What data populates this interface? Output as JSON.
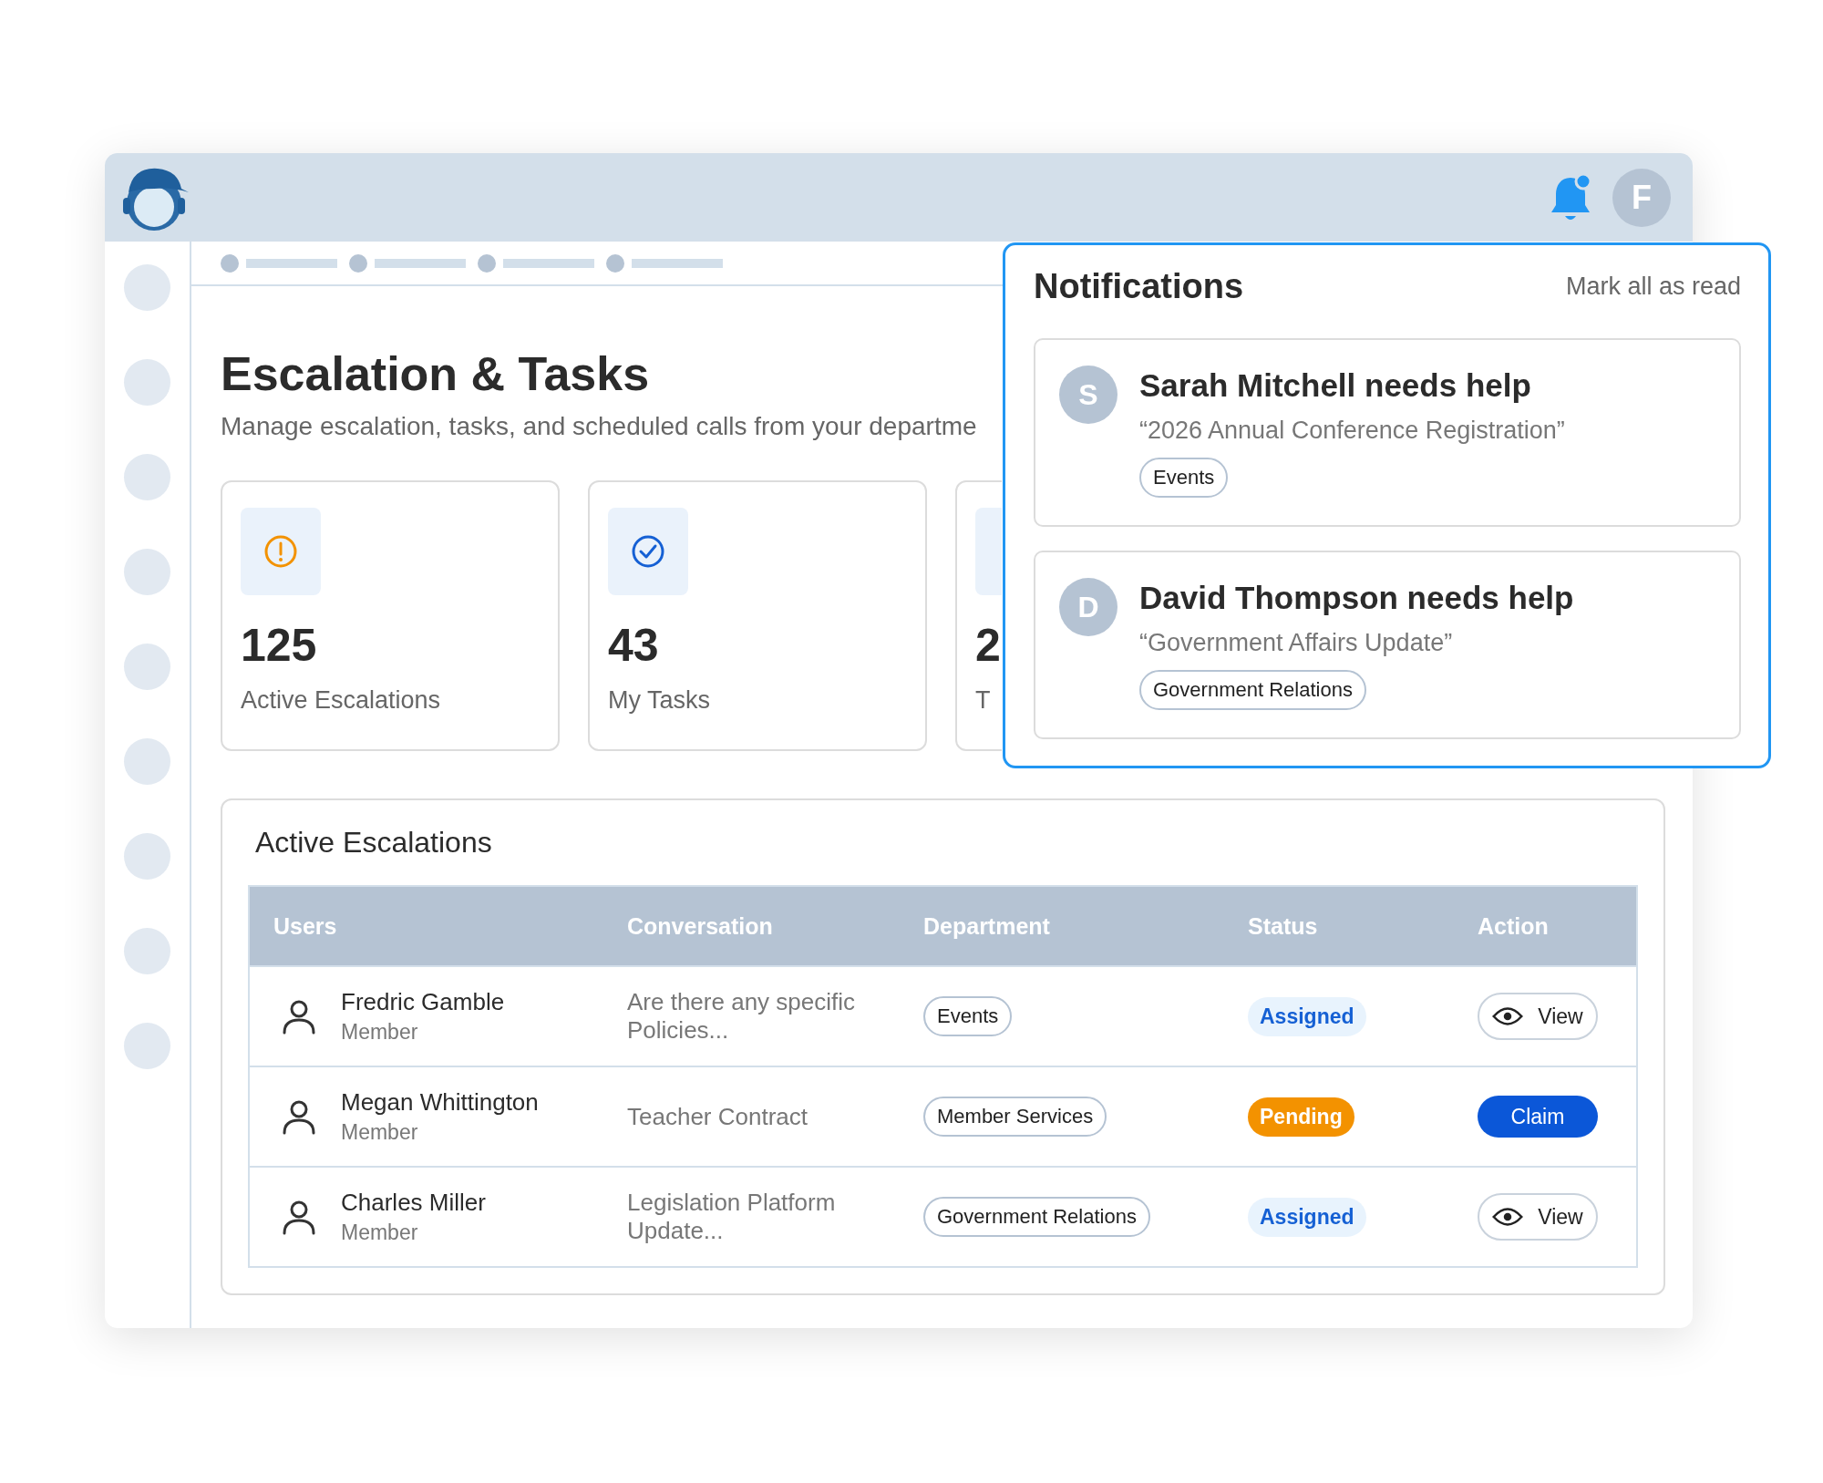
{
  "header": {
    "avatar_letter": "F",
    "notifications_unread": true
  },
  "page": {
    "title": "Escalation & Tasks",
    "subtitle": "Manage escalation, tasks, and scheduled calls from your departme"
  },
  "stats": [
    {
      "kind": "escalation",
      "value": "125",
      "label": "Active Escalations"
    },
    {
      "kind": "task",
      "value": "43",
      "label": "My Tasks"
    },
    {
      "kind": "other",
      "value": "2",
      "label": "T"
    }
  ],
  "table": {
    "title": "Active Escalations",
    "columns": [
      "Users",
      "Conversation",
      "Department",
      "Status",
      "Action"
    ],
    "rows": [
      {
        "name": "Fredric Gamble",
        "role": "Member",
        "conversation": "Are there any specific Policies...",
        "department": "Events",
        "status": {
          "kind": "assigned",
          "label": "Assigned"
        },
        "action": {
          "kind": "view",
          "label": "View"
        }
      },
      {
        "name": "Megan Whittington",
        "role": "Member",
        "conversation": "Teacher Contract",
        "department": "Member Services",
        "status": {
          "kind": "pending",
          "label": "Pending"
        },
        "action": {
          "kind": "claim",
          "label": "Claim"
        }
      },
      {
        "name": "Charles Miller",
        "role": "Member",
        "conversation": "Legislation Platform Update...",
        "department": "Government Relations",
        "status": {
          "kind": "assigned",
          "label": "Assigned"
        },
        "action": {
          "kind": "view",
          "label": "View"
        }
      }
    ]
  },
  "notifications": {
    "title": "Notifications",
    "mark_all": "Mark all as read",
    "items": [
      {
        "initial": "S",
        "title": "Sarah Mitchell needs help",
        "subject": "“2026 Annual Conference Registration”",
        "tag": "Events"
      },
      {
        "initial": "D",
        "title": "David Thompson needs help",
        "subject": "“Government Affairs Update”",
        "tag": "Government Relations"
      }
    ]
  }
}
